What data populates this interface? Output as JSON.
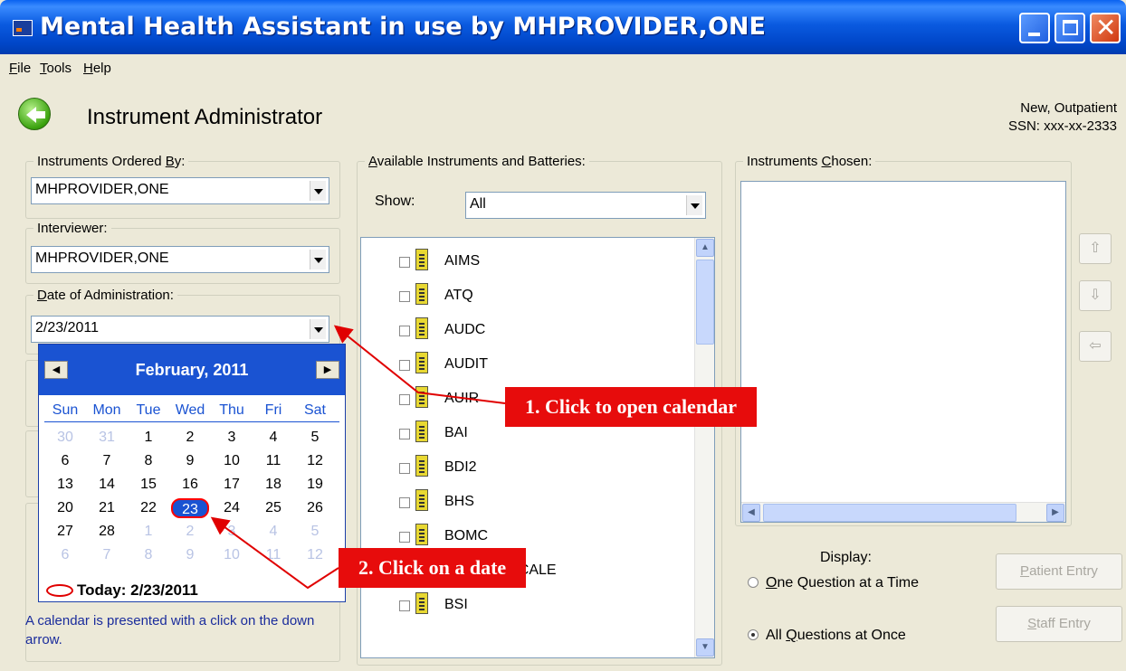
{
  "window": {
    "title": "Mental Health Assistant in use by MHPROVIDER,ONE"
  },
  "menu": [
    {
      "label": "File",
      "underline": "F",
      "rest": "ile"
    },
    {
      "label": "Tools",
      "underline": "T",
      "rest": "ools"
    },
    {
      "label": "Help",
      "underline": "H",
      "rest": "elp"
    }
  ],
  "header": {
    "title": "Instrument Administrator",
    "patient_status": "New, Outpatient",
    "ssn": "SSN: xxx-xx-2333"
  },
  "ordered_by": {
    "legend_prefix": "Instruments Ordered ",
    "legend_u": "B",
    "legend_suffix": "y:",
    "value": "MHPROVIDER,ONE"
  },
  "interviewer": {
    "legend": "Interviewer:",
    "value": "MHPROVIDER,ONE"
  },
  "date_admin": {
    "legend_u": "D",
    "legend_rest": "ate of Administration:",
    "value": "2/23/2011"
  },
  "calendar": {
    "month_title": "February, 2011",
    "prev": "◀",
    "next": "▶",
    "day_names": [
      "Sun",
      "Mon",
      "Tue",
      "Wed",
      "Thu",
      "Fri",
      "Sat"
    ],
    "weeks": [
      [
        {
          "d": "30",
          "dim": true
        },
        {
          "d": "31",
          "dim": true
        },
        {
          "d": "1"
        },
        {
          "d": "2"
        },
        {
          "d": "3"
        },
        {
          "d": "4"
        },
        {
          "d": "5"
        }
      ],
      [
        {
          "d": "6"
        },
        {
          "d": "7"
        },
        {
          "d": "8"
        },
        {
          "d": "9"
        },
        {
          "d": "10"
        },
        {
          "d": "11"
        },
        {
          "d": "12"
        }
      ],
      [
        {
          "d": "13"
        },
        {
          "d": "14"
        },
        {
          "d": "15"
        },
        {
          "d": "16"
        },
        {
          "d": "17"
        },
        {
          "d": "18"
        },
        {
          "d": "19"
        }
      ],
      [
        {
          "d": "20"
        },
        {
          "d": "21"
        },
        {
          "d": "22"
        },
        {
          "d": "23",
          "sel": true
        },
        {
          "d": "24"
        },
        {
          "d": "25"
        },
        {
          "d": "26"
        }
      ],
      [
        {
          "d": "27"
        },
        {
          "d": "28"
        },
        {
          "d": "1",
          "dim": true
        },
        {
          "d": "2",
          "dim": true
        },
        {
          "d": "3",
          "dim": true
        },
        {
          "d": "4",
          "dim": true
        },
        {
          "d": "5",
          "dim": true
        }
      ],
      [
        {
          "d": "6",
          "dim": true
        },
        {
          "d": "7",
          "dim": true
        },
        {
          "d": "8",
          "dim": true
        },
        {
          "d": "9",
          "dim": true
        },
        {
          "d": "10",
          "dim": true
        },
        {
          "d": "11",
          "dim": true
        },
        {
          "d": "12",
          "dim": true
        }
      ]
    ],
    "today": "Today: 2/23/2011"
  },
  "hint_text": "A calendar is presented with a click on the down arrow.",
  "available": {
    "legend_u": "A",
    "legend_rest": "vailable Instruments and Batteries:",
    "show_label": "Show:",
    "show_value": "All",
    "items": [
      "AIMS",
      "ATQ",
      "AUDC",
      "AUDIT",
      "AUIR",
      "BAI",
      "BDI2",
      "BHS",
      "BOMC",
      "BRADEN SCALE",
      "BSI"
    ]
  },
  "chosen": {
    "legend_prefix": "Instruments ",
    "legend_u": "C",
    "legend_suffix": "hosen:"
  },
  "display": {
    "label": "Display:",
    "option_one_u": "O",
    "option_one_rest": "ne Question at a Time",
    "option_all_prefix": "All ",
    "option_all_u": "Q",
    "option_all_rest": "uestions at Once",
    "selected": "all",
    "patient_entry_u": "P",
    "patient_entry_rest": "atient Entry",
    "staff_entry_u": "S",
    "staff_entry_rest": "taff Entry"
  },
  "callouts": {
    "step1": "1. Click to open calendar",
    "step2": "2. Click on a date"
  },
  "colors": {
    "titlebar": "#0a5ae0",
    "callout": "#e70c0c",
    "calendar_header": "#1a53d2"
  }
}
